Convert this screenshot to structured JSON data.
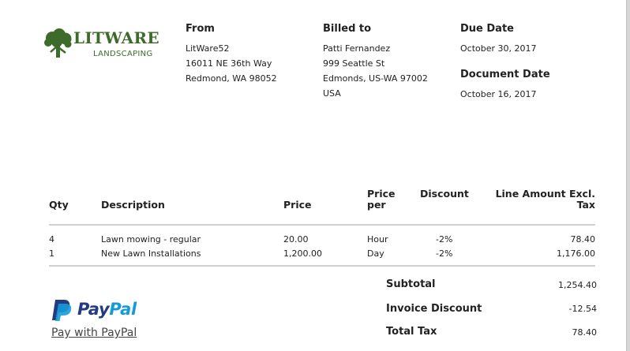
{
  "logo": {
    "name": "LITWARE",
    "tagline": "LANDSCAPING",
    "icon": "tree-icon",
    "color": "#3d6b2b"
  },
  "from": {
    "heading": "From",
    "lines": [
      "LitWare52",
      "16011 NE 36th Way",
      "Redmond, WA 98052"
    ]
  },
  "billed_to": {
    "heading": "Billed to",
    "lines": [
      "Patti Fernandez",
      "999 Seattle St",
      "Edmonds, US-WA 97002",
      "USA"
    ]
  },
  "due_date": {
    "heading": "Due Date",
    "value": "October 30, 2017"
  },
  "document_date": {
    "heading": "Document Date",
    "value": "October 16, 2017"
  },
  "table": {
    "headers": {
      "qty": "Qty",
      "description": "Description",
      "price": "Price",
      "price_per": [
        "Price",
        "per"
      ],
      "discount": "Discount",
      "line_amount": [
        "Line Amount Excl.",
        "Tax"
      ]
    },
    "rows": [
      {
        "qty": "4",
        "description": "Lawn mowing - regular",
        "price": "20.00",
        "per": "Hour",
        "discount": "-2%",
        "amount": "78.40"
      },
      {
        "qty": "1",
        "description": "New Lawn Installations",
        "price": "1,200.00",
        "per": "Day",
        "discount": "-2%",
        "amount": "1,176.00"
      }
    ]
  },
  "summary": [
    {
      "label": "Subtotal",
      "value": "1,254.40"
    },
    {
      "label": "Invoice Discount",
      "value": "-12.54"
    },
    {
      "label": "Total Tax",
      "value": "78.40"
    }
  ],
  "paypal": {
    "word_a": "Pay",
    "word_b": "Pal",
    "link": "Pay with PayPal",
    "icon": "paypal-icon",
    "colors": {
      "dark": "#253b80",
      "light": "#179bd7"
    }
  }
}
